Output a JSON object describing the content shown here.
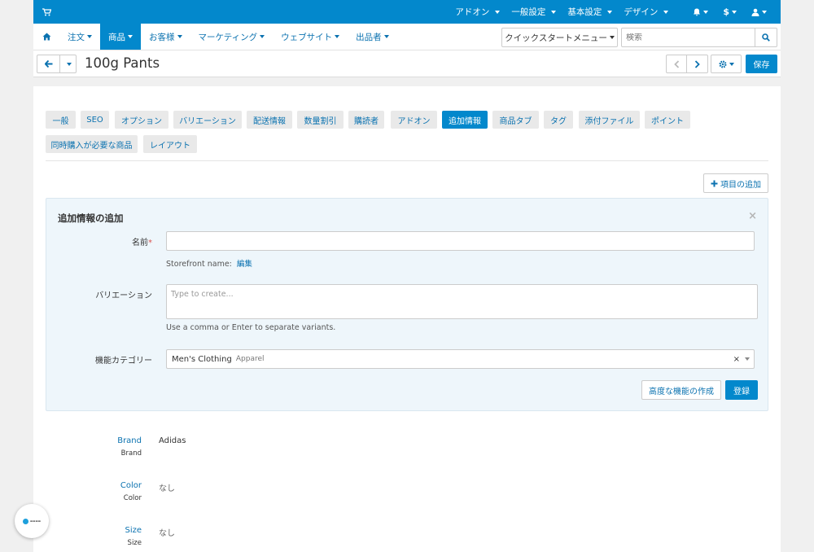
{
  "topbar": {
    "menus": [
      "アドオン",
      "一般設定",
      "基本設定",
      "デザイン"
    ],
    "currency": "$"
  },
  "nav": {
    "items": [
      {
        "label": "注文",
        "active": false
      },
      {
        "label": "商品",
        "active": true
      },
      {
        "label": "お客様",
        "active": false
      },
      {
        "label": "マーケティング",
        "active": false
      },
      {
        "label": "ウェブサイト",
        "active": false
      },
      {
        "label": "出品者",
        "active": false
      }
    ],
    "quick_menu": "クイックスタートメニュー",
    "search_placeholder": "検索"
  },
  "titlebar": {
    "title": "100g Pants",
    "save": "保存"
  },
  "tabs": {
    "items": [
      {
        "label": "一般"
      },
      {
        "label": "SEO"
      },
      {
        "label": "オプション"
      },
      {
        "label": "バリエーション"
      },
      {
        "label": "配送情報"
      },
      {
        "label": "数量割引"
      },
      {
        "label": "購読者"
      },
      {
        "label": "アドオン"
      },
      {
        "label": "追加情報",
        "active": true
      },
      {
        "label": "商品タブ"
      },
      {
        "label": "タグ"
      },
      {
        "label": "添付ファイル"
      },
      {
        "label": "ポイント"
      },
      {
        "label": "同時購入が必要な商品"
      },
      {
        "label": "レイアウト"
      }
    ]
  },
  "add_item_button": "項目の追加",
  "panel": {
    "title": "追加情報の追加",
    "name_label": "名前",
    "name_required_mark": "*",
    "name_value": "",
    "storefront_label": "Storefront name:",
    "storefront_edit": "編集",
    "variation_label": "バリエーション",
    "variation_placeholder": "Type to create...",
    "variation_hint": "Use a comma or Enter to separate variants.",
    "category_label": "機能カテゴリー",
    "category_value": "Men's Clothing",
    "category_sub": "Apparel",
    "advanced_button": "高度な機能の作成",
    "register_button": "登録"
  },
  "features": [
    {
      "name": "Brand",
      "sub": "Brand",
      "value": "Adidas",
      "empty": false
    },
    {
      "name": "Color",
      "sub": "Color",
      "value": "なし",
      "empty": true
    },
    {
      "name": "Size",
      "sub": "Size",
      "value": "なし",
      "empty": true
    }
  ],
  "colors": {
    "primary": "#0388cc",
    "link": "#0b72b0",
    "panel_bg": "#eef6fb"
  }
}
